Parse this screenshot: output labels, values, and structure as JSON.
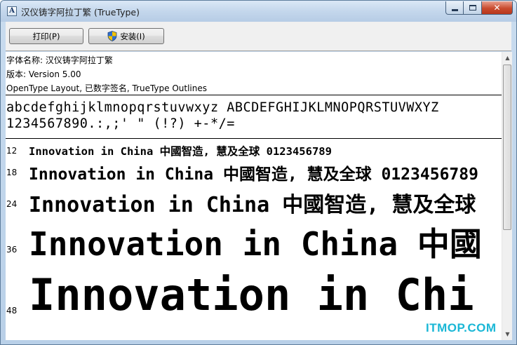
{
  "window": {
    "title": "汉仪铸字阿拉丁繁 (TrueType)",
    "app_icon_glyph": "A",
    "close_glyph": "✕"
  },
  "toolbar": {
    "print_label": "打印(P)",
    "install_label": "安装(I)"
  },
  "font_info": {
    "name_line": "字体名称: 汉仪铸字阿拉丁繁",
    "version_line": "版本: Version 5.00",
    "type_line": "OpenType Layout, 已数字签名, TrueType Outlines"
  },
  "character_set": {
    "line1": "abcdefghijklmnopqrstuvwxyz ABCDEFGHIJKLMNOPQRSTUVWXYZ",
    "line2": "1234567890.:,;' \" (!?) +-*/="
  },
  "samples": [
    {
      "size": "12",
      "text": "Innovation in China 中國智造, 慧及全球 0123456789"
    },
    {
      "size": "18",
      "text": "Innovation in China 中國智造, 慧及全球 0123456789"
    },
    {
      "size": "24",
      "text": "Innovation in China 中國智造, 慧及全球"
    },
    {
      "size": "36",
      "text": "Innovation in China 中國"
    },
    {
      "size": "48",
      "text": "Innovation in Chi"
    }
  ],
  "watermark": "ITMOP.COM",
  "colors": {
    "title_close": "#c94b2e",
    "watermark": "#1ab7d6",
    "shield_blue": "#2f6fd0",
    "shield_yellow": "#f2c200"
  }
}
